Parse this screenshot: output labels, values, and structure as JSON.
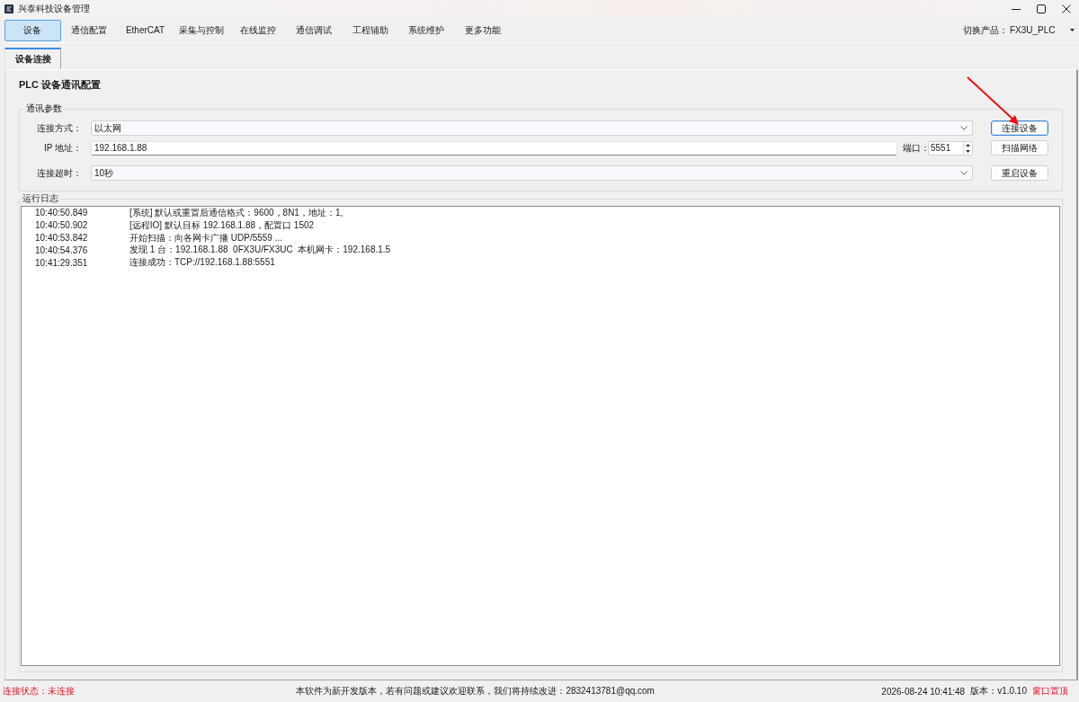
{
  "window": {
    "title": "兴泰科技设备管理"
  },
  "menu": {
    "items": [
      {
        "label": "设备",
        "selected": true
      },
      {
        "label": "通信配置",
        "selected": false
      },
      {
        "label": "EtherCAT",
        "selected": false
      },
      {
        "label": "采集与控制",
        "selected": false
      },
      {
        "label": "在线监控",
        "selected": false
      },
      {
        "label": "通信调试",
        "selected": false
      },
      {
        "label": "工程辅助",
        "selected": false
      },
      {
        "label": "系统维护",
        "selected": false
      },
      {
        "label": "更多功能",
        "selected": false
      }
    ],
    "product_switch": {
      "label": "切换产品：",
      "value": "FX3U_PLC"
    }
  },
  "sub_tabs": [
    {
      "label": "设备连接",
      "selected": true
    }
  ],
  "page": {
    "title": "PLC 设备通讯配置"
  },
  "params": {
    "title": "通讯参数",
    "rows": [
      {
        "kind": "select",
        "label": "连接方式：",
        "value": "以太网",
        "button": {
          "label": "连接设备",
          "focused": true
        }
      },
      {
        "kind": "input",
        "label": "IP 地址：",
        "value": "192.168.1.88",
        "port": {
          "label": "端口：",
          "value": "5551"
        },
        "button": {
          "label": "扫描网络",
          "focused": false
        }
      },
      {
        "kind": "select",
        "label": "连接超时：",
        "value": "10秒",
        "button": {
          "label": "重启设备",
          "focused": false
        }
      }
    ]
  },
  "log": {
    "title": "运行日志",
    "entries": [
      {
        "time": "10:40:50.849",
        "message": "[系统] 默认或重置后通信格式：9600，8N1，地址：1。"
      },
      {
        "time": "10:40:50.902",
        "message": "[远程IO] 默认目标 192.168.1.88，配置口 1502"
      },
      {
        "time": "10:40:53.842",
        "message": "开始扫描：向各网卡广播 UDP/5559 ..."
      },
      {
        "time": "10:40:54.376",
        "message": "发现 1 台：192.168.1.88  0FX3U/FX3UC  本机网卡：192.168.1.5"
      },
      {
        "time": "10:41:29.351",
        "message": "连接成功：TCP://192.168.1.88:5551"
      }
    ]
  },
  "status_bar": {
    "connection": {
      "text": "连接状态：未连接",
      "connected": false
    },
    "notice": "本软件为新开发版本，若有问题或建议欢迎联系，我们将持续改进：2832413781@qq.com",
    "datetime": "2026-08-24 10:41:48",
    "version": "版本：v1.0.10",
    "pin": "窗口置顶"
  }
}
